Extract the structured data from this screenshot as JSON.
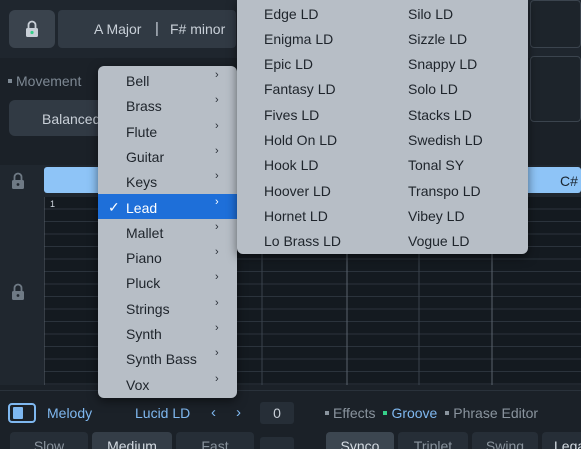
{
  "header": {
    "key_major": "A Major",
    "key_separator": "|",
    "key_minor": "F# minor"
  },
  "movement": {
    "label": "Movement",
    "button_label": "Balanced"
  },
  "timeline": {
    "chord_label": "C#",
    "bar_number": "1"
  },
  "bottom": {
    "track_label": "Melody",
    "preset_name": "Lucid LD",
    "prev_symbol": "‹",
    "next_symbol": "›",
    "counter_value": "0",
    "tabs": [
      {
        "label": "Effects",
        "color": "#8a949e"
      },
      {
        "label": "Groove",
        "color": "#7fb8f0"
      },
      {
        "label": "Phrase Editor",
        "color": "#8a949e"
      }
    ],
    "speeds": [
      "Slow",
      "Medium",
      "Fast"
    ],
    "groove_styles": [
      "Synco",
      "Triplet",
      "Swing",
      "Legato"
    ]
  },
  "category_menu": {
    "check_mark": "✓",
    "arrow": "›",
    "items": [
      "Bell",
      "Brass",
      "Flute",
      "Guitar",
      "Keys",
      "Lead",
      "Mallet",
      "Piano",
      "Pluck",
      "Strings",
      "Synth",
      "Synth Bass",
      "Vox"
    ],
    "selected": "Lead"
  },
  "preset_menu": {
    "column1": [
      "Edge LD",
      "Enigma LD",
      "Epic LD",
      "Fantasy LD",
      "Fives LD",
      "Hold On LD",
      "Hook LD",
      "Hoover LD",
      "Hornet LD",
      "Lo Brass LD"
    ],
    "column2": [
      "Silo LD",
      "Sizzle LD",
      "Snappy LD",
      "Solo LD",
      "Stacks LD",
      "Swedish LD",
      "Tonal SY",
      "Transpo LD",
      "Vibey LD",
      "Vogue LD"
    ]
  },
  "colors": {
    "accent": "#7fb8f0",
    "selection": "#1e6fd9",
    "menu_bg": "#b7bec6",
    "timeline_bar": "#8ec4f7"
  }
}
